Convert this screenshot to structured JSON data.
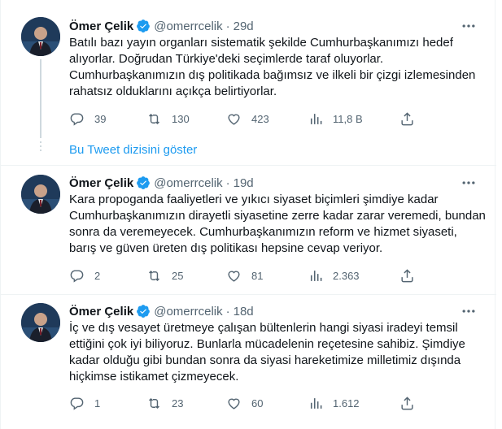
{
  "colors": {
    "accent": "#1d9bf0",
    "muted": "#536471",
    "text": "#0f1419",
    "verified": "#1d9bf0"
  },
  "show_thread": "Bu Tweet dizisini göster",
  "tweets": [
    {
      "name": "Ömer Çelik",
      "handle": "@omerrcelik",
      "sep": "·",
      "time": "29d",
      "lines": [
        "Batılı bazı yayın organları sistematik şekilde Cumhurbaşkanımızı hedef",
        "alıyorlar. Doğrudan Türkiye'deki seçimlerde taraf oluyorlar.",
        "Cumhurbaşkanımızın dış politikada bağımsız ve ilkeli bir çizgi izlemesinden",
        "rahatsız olduklarını açıkça belirtiyorlar."
      ],
      "replies": "39",
      "retweets": "130",
      "likes": "423",
      "views": "11,8 B"
    },
    {
      "name": "Ömer Çelik",
      "handle": "@omerrcelik",
      "sep": "·",
      "time": "19d",
      "lines": [
        "Kara propoganda faaliyetleri ve yıkıcı siyaset biçimleri şimdiye kadar",
        "Cumhurbaşkanımızın dirayetli siyasetine zerre kadar zarar veremedi, bundan",
        "sonra da veremeyecek. Cumhurbaşkanımızın reform ve hizmet siyaseti,",
        "barış ve güven üreten dış politikası hepsine cevap veriyor."
      ],
      "replies": "2",
      "retweets": "25",
      "likes": "81",
      "views": "2.363"
    },
    {
      "name": "Ömer Çelik",
      "handle": "@omerrcelik",
      "sep": "·",
      "time": "18d",
      "lines": [
        "İç ve dış vesayet üretmeye çalışan bültenlerin hangi siyasi iradeyi temsil",
        "ettiğini çok iyi biliyoruz. Bunlarla mücadelenin reçetesine sahibiz. Şimdiye",
        "kadar olduğu gibi bundan sonra da siyasi hareketimize milletimiz dışında",
        "hiçkimse istikamet çizmeyecek."
      ],
      "replies": "1",
      "retweets": "23",
      "likes": "60",
      "views": "1.612"
    }
  ]
}
